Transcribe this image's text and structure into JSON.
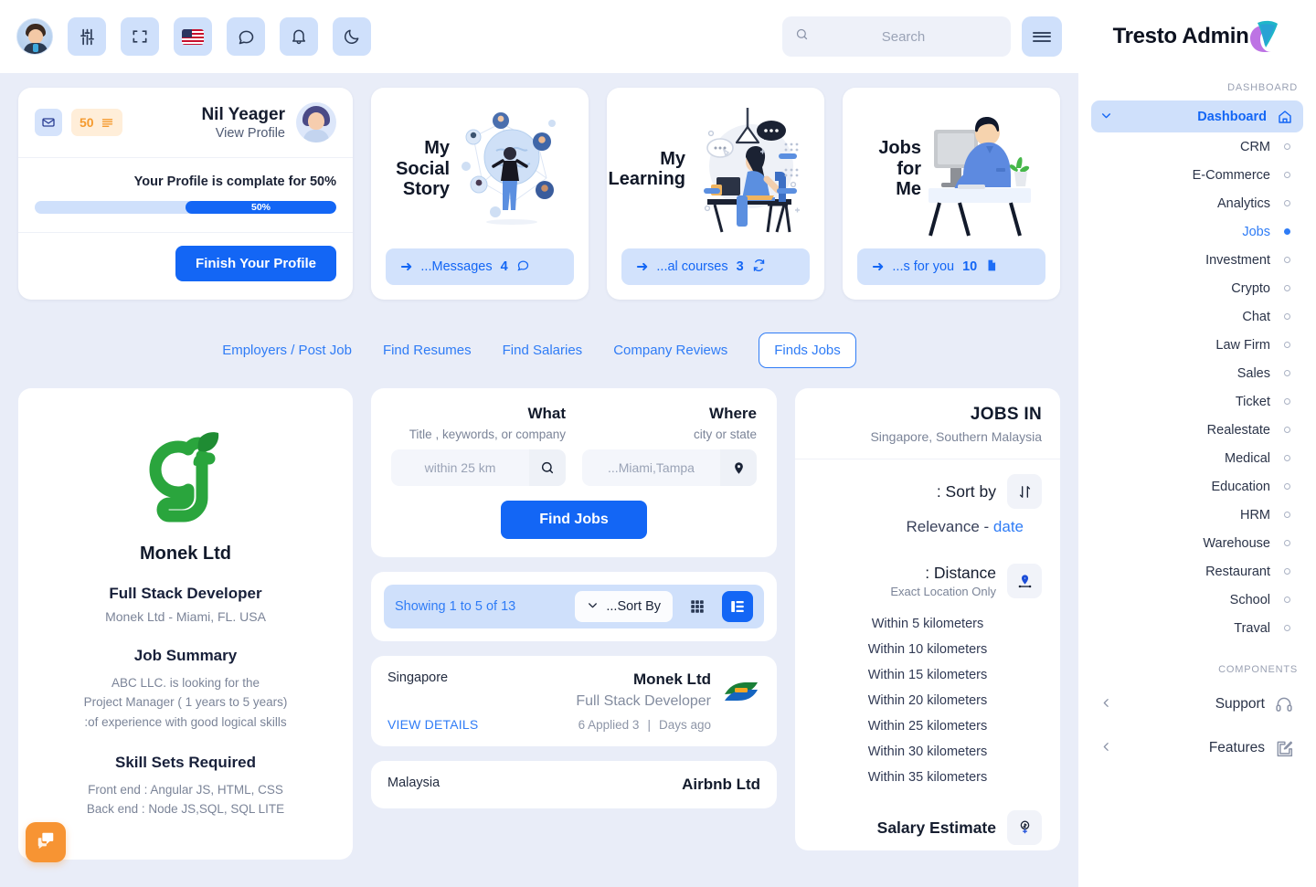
{
  "topbar": {
    "avatar_name": "user-avatar",
    "icons": [
      {
        "name": "settings-sliders-icon",
        "label": "Settings"
      },
      {
        "name": "fullscreen-icon",
        "label": "Fullscreen"
      },
      {
        "name": "language-flag-icon",
        "label": "English (US)"
      },
      {
        "name": "chat-icon",
        "label": "Messages"
      },
      {
        "name": "bell-icon",
        "label": "Notifications"
      },
      {
        "name": "moon-icon",
        "label": "Dark mode"
      }
    ],
    "search": {
      "placeholder": "Search",
      "value": ""
    },
    "menu_label": "Menu"
  },
  "brand": {
    "title": "Tresto Admin"
  },
  "profile_card": {
    "mail_badge": "mail-icon",
    "count_badge": "50",
    "name": "Nil Yeager",
    "view_profile": "View Profile",
    "complete_text": "Your Profile is complate for 50%",
    "progress_label": "50%",
    "progress_percent": 50,
    "finish_button": "Finish Your Profile"
  },
  "feature_cards": [
    {
      "title": "My\nSocial\nStory",
      "cta_prefix": "...Messages",
      "cta_count": "4",
      "cta_icon": "chat-bubble-icon",
      "illus": "social-network-illustration"
    },
    {
      "title": "My\nLearning",
      "cta_prefix": "...al courses",
      "cta_count": "3",
      "cta_icon": "refresh-icon",
      "illus": "desk-learning-illustration"
    },
    {
      "title": "Jobs\nfor\nMe",
      "cta_prefix": "...s for you",
      "cta_count": "10",
      "cta_icon": "document-icon",
      "illus": "office-worker-illustration"
    }
  ],
  "tabs": [
    {
      "label": "Employers / Post Job",
      "active": false
    },
    {
      "label": "Find Resumes",
      "active": false
    },
    {
      "label": "Find Salaries",
      "active": false
    },
    {
      "label": "Company Reviews",
      "active": false
    },
    {
      "label": "Finds Jobs",
      "active": true
    }
  ],
  "job_detail": {
    "company": "Monek Ltd",
    "role": "Full Stack Developer",
    "location": "Monek Ltd - Miami, FL. USA",
    "summary_heading": "Job Summary",
    "summary_lines": [
      "ABC LLC. is looking for the",
      "Project Manager ( 1 years to 5 years)",
      ":of experience with good logical skills"
    ],
    "skills_heading": "Skill Sets Required",
    "skills_lines": [
      "Front end : Angular JS, HTML, CSS",
      "Back end : Node JS,SQL, SQL LITE"
    ]
  },
  "job_search": {
    "where_label": "Where",
    "where_sub": "city or state",
    "where_placeholder": "...Miami,Tampa",
    "where_value": "",
    "where_icon": "map-pin-icon",
    "what_label": "What",
    "what_sub": "Title , keywords, or company",
    "what_placeholder": "within 25 km",
    "what_value": "",
    "what_icon": "search-icon",
    "submit_label": "Find Jobs"
  },
  "toolbar": {
    "list_view": "list-view-icon",
    "grid_view": "grid-view-icon",
    "sort_label": "...Sort By",
    "showing": "Showing 1 to 5 of 13"
  },
  "job_list": [
    {
      "country": "Singapore",
      "company": "Monek Ltd",
      "role": "Full Stack Developer",
      "posted": "Days ago",
      "separator": "|",
      "applied": "6 Applied 3",
      "details_label": "VIEW DETAILS",
      "logo": "green-blue-swoosh-logo"
    },
    {
      "country": "Malaysia",
      "company": "Airbnb Ltd",
      "role": "",
      "posted": "",
      "separator": "",
      "applied": "",
      "details_label": "",
      "logo": ""
    }
  ],
  "filters": {
    "title": "JOBS IN",
    "subtitle": "Singapore, Southern Malaysia",
    "sort_label": ": Sort by",
    "sort_icon": "sort-arrows-icon",
    "sort_value_prefix": "Relevance - ",
    "sort_value_active": "date",
    "distance_label": ": Distance",
    "distance_sub": "Exact Location Only",
    "distance_icon": "location-distance-icon",
    "distance_options": [
      "Within 5 kilometers",
      "Within 10 kilometers",
      "Within 15 kilometers",
      "Within 20 kilometers",
      "Within 25 kilometers",
      "Within 30 kilometers",
      "Within 35 kilometers"
    ],
    "salary_label": "Salary Estimate",
    "salary_icon": "salary-money-icon"
  },
  "sidebar": {
    "caption_dashboard": "DASHBOARD",
    "caption_components": "COMPONENTS",
    "dashboard_item": {
      "label": "Dashboard",
      "icon": "home-icon",
      "active": true
    },
    "items": [
      {
        "label": "CRM",
        "current": false
      },
      {
        "label": "E-Commerce",
        "current": false
      },
      {
        "label": "Analytics",
        "current": false
      },
      {
        "label": "Jobs",
        "current": true
      },
      {
        "label": "Investment",
        "current": false
      },
      {
        "label": "Crypto",
        "current": false
      },
      {
        "label": "Chat",
        "current": false
      },
      {
        "label": "Law Firm",
        "current": false
      },
      {
        "label": "Sales",
        "current": false
      },
      {
        "label": "Ticket",
        "current": false
      },
      {
        "label": "Realestate",
        "current": false
      },
      {
        "label": "Medical",
        "current": false
      },
      {
        "label": "Education",
        "current": false
      },
      {
        "label": "HRM",
        "current": false
      },
      {
        "label": "Warehouse",
        "current": false
      },
      {
        "label": "Restaurant",
        "current": false
      },
      {
        "label": "School",
        "current": false
      },
      {
        "label": "Traval",
        "current": false
      }
    ],
    "footer_items": [
      {
        "label": "Support",
        "icon": "headphones-icon"
      },
      {
        "label": "Features",
        "icon": "edit-square-icon"
      }
    ]
  },
  "fab": {
    "name": "chat-fab",
    "icon": "speech-bubbles-icon"
  },
  "colors": {
    "accent": "#1366f5",
    "accent_light": "#cfe0fb",
    "link": "#2f7cf6",
    "orange": "#f79433",
    "bg": "#e9edf8"
  }
}
